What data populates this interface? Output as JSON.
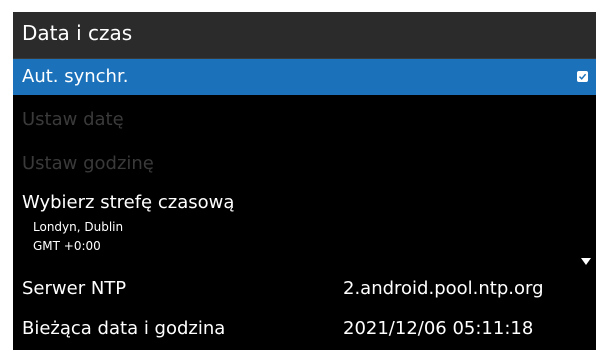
{
  "header": {
    "title": "Data i czas"
  },
  "items": [
    {
      "label": "Aut. synchr.",
      "checked": true
    },
    {
      "label": "Ustaw datę"
    },
    {
      "label": "Ustaw godzinę"
    },
    {
      "label": "Wybierz strefę czasową",
      "sub1": "Londyn, Dublin",
      "sub2": "GMT +0:00"
    },
    {
      "label": "Serwer NTP",
      "value": "2.android.pool.ntp.org"
    },
    {
      "label": "Bieżąca data i godzina",
      "value": "2021/12/06 05:11:18"
    }
  ],
  "colors": {
    "accent": "#1c72ba",
    "disabled_text": "#3a3a3a"
  },
  "icons": {
    "checkbox": "checkbox-checked-icon",
    "scroll": "chevron-down-icon"
  }
}
